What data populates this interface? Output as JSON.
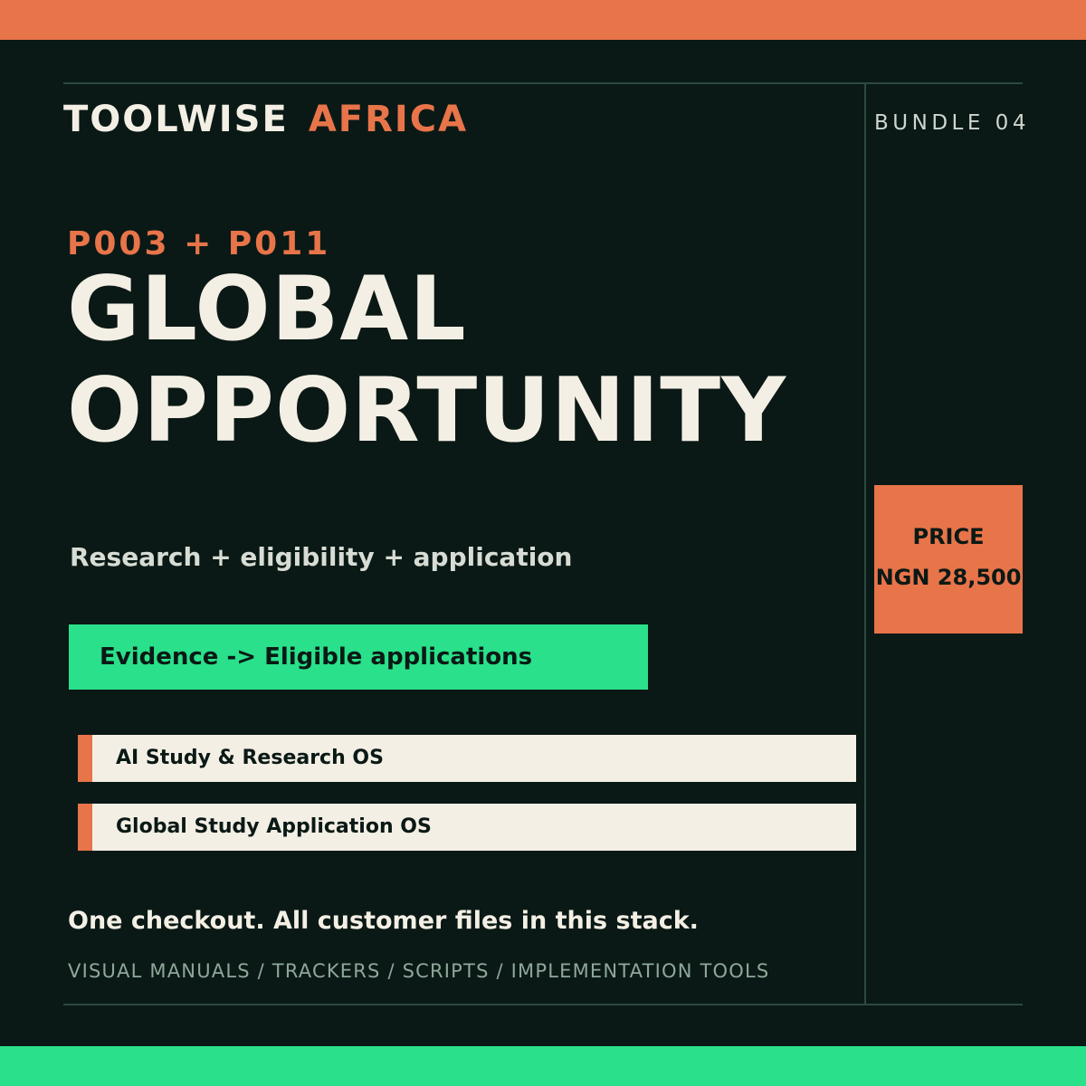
{
  "brand": {
    "name": "TOOLWISE",
    "region": "AFRICA"
  },
  "bundle_tag": "BUNDLE 04",
  "product_codes": "P003 + P011",
  "title": {
    "line1": "GLOBAL",
    "line2": "OPPORTUNITY"
  },
  "subtitle": "Research + eligibility + application",
  "outcome_banner": "Evidence -> Eligible applications",
  "products": [
    {
      "name": "AI Study & Research OS"
    },
    {
      "name": "Global Study Application OS"
    }
  ],
  "price": {
    "label": "PRICE",
    "value": "NGN 28,500"
  },
  "footer": {
    "checkout": "One checkout. All customer files in this stack.",
    "contents": "VISUAL MANUALS / TRACKERS / SCRIPTS / IMPLEMENTATION TOOLS"
  },
  "colors": {
    "background": "#0a1915",
    "accent_orange": "#e8744a",
    "accent_green": "#2ae08a",
    "cream": "#f4efe5"
  }
}
